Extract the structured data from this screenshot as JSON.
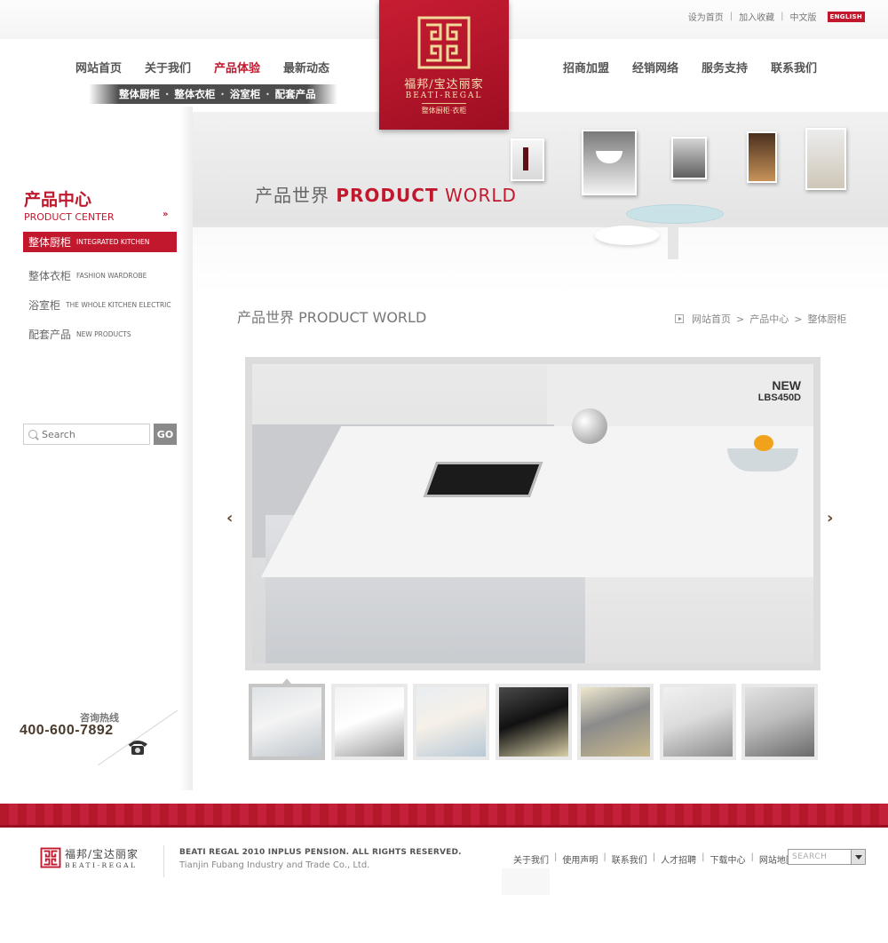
{
  "util_links": [
    "设为首页",
    "加入收藏",
    "中文版"
  ],
  "lang_button": "ENGLISH",
  "nav_left": [
    {
      "label": "网站首页",
      "active": false
    },
    {
      "label": "关于我们",
      "active": false
    },
    {
      "label": "产品体验",
      "active": true
    },
    {
      "label": "最新动态",
      "active": false
    }
  ],
  "nav_right": [
    "招商加盟",
    "经销网络",
    "服务支持",
    "联系我们"
  ],
  "subnav": [
    "整体厨柜",
    "整体衣柜",
    "浴室柜",
    "配套产品"
  ],
  "logo": {
    "cn": "福邦/宝达丽家",
    "en": "BEATI-REGAL",
    "tag": "整体厨柜·衣柜"
  },
  "banner": {
    "cn": "产品世界",
    "en_bold": "PRODUCT",
    "en_light": "WORLD"
  },
  "sidebar": {
    "title_cn": "产品中心",
    "title_en": "PRODUCT CENTER",
    "arrow": "»",
    "items": [
      {
        "cn": "整体厨柜",
        "en": "INTEGRATED KITCHEN",
        "active": true
      },
      {
        "cn": "整体衣柜",
        "en": "FASHION WARDROBE",
        "active": false
      },
      {
        "cn": "浴室柜",
        "en": "THE WHOLE KITCHEN ELECTRIC",
        "active": false
      },
      {
        "cn": "配套产品",
        "en": "NEW PRODUCTS",
        "active": false
      }
    ]
  },
  "search": {
    "placeholder": "Search",
    "button": "GO"
  },
  "hotline": {
    "label": "咨询热线",
    "number": "400-600-7892"
  },
  "section_title": "产品世界 PRODUCT WORLD",
  "breadcrumb": [
    "网站首页",
    "产品中心",
    "整体厨柜"
  ],
  "product": {
    "badge": "NEW",
    "model": "LBS450D"
  },
  "arrows": {
    "prev": "‹",
    "next": "›"
  },
  "thumbnails": [
    {
      "subject": "kitchen-island",
      "colors": [
        "#dfe3e6",
        "#bfc6cc",
        "#f4f4f4"
      ],
      "active": true
    },
    {
      "subject": "teacup",
      "colors": [
        "#f2f2f2",
        "#9a9a9a",
        "#ffffff"
      ],
      "active": false
    },
    {
      "subject": "bar-stools",
      "colors": [
        "#e8eef2",
        "#b7c9d6",
        "#f6f0e8"
      ],
      "active": false
    },
    {
      "subject": "oven",
      "colors": [
        "#4a4a4a",
        "#d8cfa8",
        "#111111"
      ],
      "active": false
    },
    {
      "subject": "beige-kitchen",
      "colors": [
        "#efe8cf",
        "#c9b98c",
        "#8b8b8b"
      ],
      "active": false
    },
    {
      "subject": "woman-coffee",
      "colors": [
        "#f1f1f1",
        "#8c8c8c",
        "#dcdcdc"
      ],
      "active": false
    },
    {
      "subject": "sink-faucet",
      "colors": [
        "#e3e3e3",
        "#6a6a6a",
        "#bdbdbd"
      ],
      "active": false
    }
  ],
  "footer": {
    "logo_cn": "福邦/宝达丽家",
    "logo_en": "BEATI-REGAL",
    "copyright": "BEATI REGAL   2010 INPLUS PENSION. ALL RIGHTS RESERVED.",
    "company": "Tianjin Fubang Industry and Trade Co., Ltd.",
    "links": [
      "关于我们",
      "使用声明",
      "联系我们",
      "人才招聘",
      "下载中心",
      "网站地图"
    ],
    "select_value": "SEARCH"
  },
  "colors": {
    "accent": "#c2182e",
    "footer_band": "#b5182b",
    "hotline": "#4a3a2c"
  }
}
